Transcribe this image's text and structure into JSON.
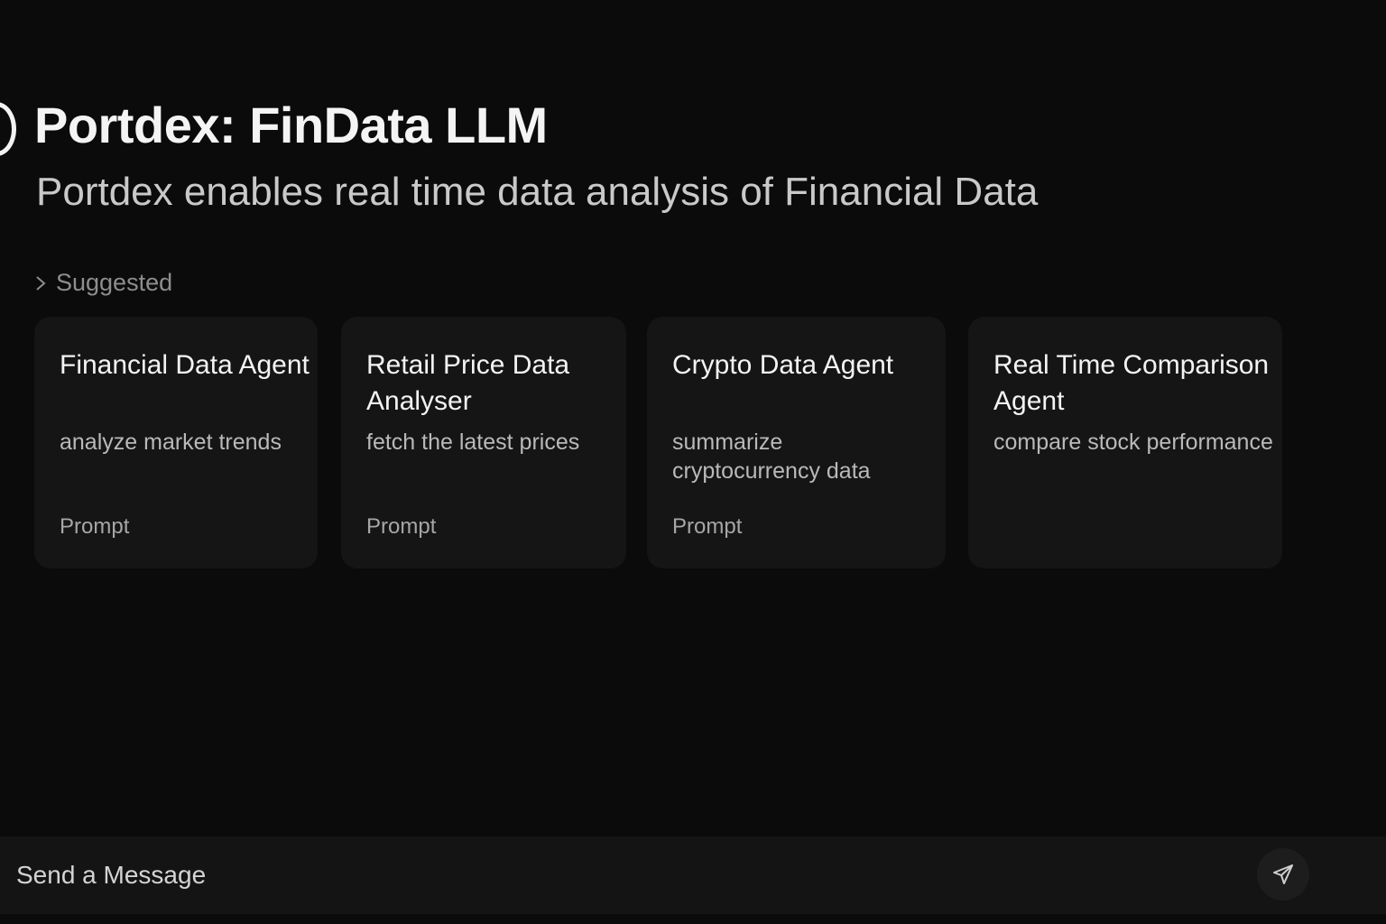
{
  "header": {
    "title": "Portdex: FinData LLM",
    "subtitle": "Portdex enables real time data analysis of Financial Data",
    "logo_icon": "circle-logo-icon"
  },
  "suggested": {
    "label": "Suggested",
    "icon": "chevron-right-icon",
    "cards": [
      {
        "title": "Financial Data Agent",
        "description": "analyze market trends",
        "tag": "Prompt"
      },
      {
        "title": "Retail Price Data Analyser",
        "description": "fetch the latest prices",
        "tag": "Prompt"
      },
      {
        "title": "Crypto Data Agent",
        "description": "summarize cryptocurrency data",
        "tag": "Prompt"
      },
      {
        "title": "Real Time Comparison Agent",
        "description": "compare stock performance",
        "tag": ""
      }
    ]
  },
  "composer": {
    "placeholder": "Send a Message",
    "send_icon": "send-icon"
  },
  "colors": {
    "background": "#0b0b0b",
    "card": "#151515",
    "composer": "#141414"
  }
}
